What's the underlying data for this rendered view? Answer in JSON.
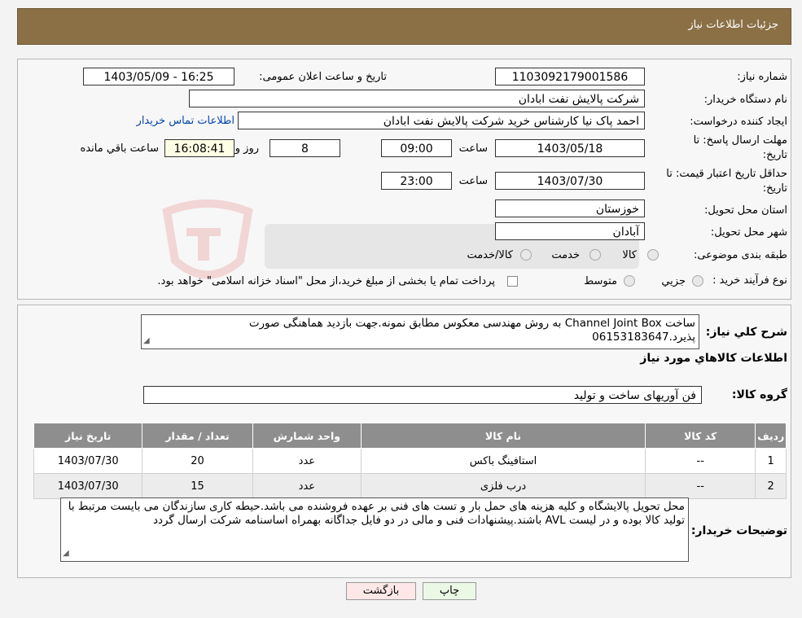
{
  "header": {
    "title": "جزئیات اطلاعات نیاز"
  },
  "form": {
    "need_number_label": "شماره نیاز:",
    "need_number": "1103092179001586",
    "announce_label": "تاریخ و ساعت اعلان عمومی:",
    "announce_value": "1403/05/09 - 16:25",
    "buyer_org_label": "نام دستگاه خریدار:",
    "buyer_org": "شرکت پالایش نفت ابادان",
    "creator_label": "ایجاد کننده درخواست:",
    "creator": "احمد پاک نیا کارشناس خرید شرکت پالایش نفت ابادان",
    "contact_link": "اطلاعات تماس خریدار",
    "deadline_label_1": "مهلت ارسال پاسخ: تا",
    "deadline_label_2": "تاریخ:",
    "deadline_date": "1403/05/18",
    "time_label": "ساعت",
    "deadline_time": "09:00",
    "days_value": "8",
    "days_label": "روز و",
    "remaining_time": "16:08:41",
    "remaining_label": "ساعت باقي مانده",
    "validity_label_1": "حداقل تاریخ اعتبار قیمت: تا",
    "validity_label_2": "تاریخ:",
    "validity_date": "1403/07/30",
    "validity_time": "23:00",
    "province_label": "استان محل تحویل:",
    "province": "خوزستان",
    "city_label": "شهر محل تحویل:",
    "city": "آبادان",
    "category_label": "طبقه بندی موضوعی:",
    "category_options": [
      "کالا",
      "خدمت",
      "کالا/خدمت"
    ],
    "process_label": "نوع فرآیند خرید :",
    "process_options": [
      "جزيي",
      "متوسط"
    ],
    "payment_note": "پرداخت تمام یا بخشی از مبلغ خرید،از محل \"اسناد خزانه اسلامی\" خواهد بود."
  },
  "description": {
    "label": "شرح كلي نياز:",
    "text": "ساخت Channel Joint Box به روش مهندسی معکوس مطابق نمونه.جهت بازدید هماهنگی صورت پذیرد.06153183647"
  },
  "goods": {
    "section_title": "اطلاعات كالاهاي مورد نياز",
    "group_label": "گروه کالا:",
    "group_value": "فن آوریهای ساخت و تولید",
    "columns": [
      "رديف",
      "كد كالا",
      "نام كالا",
      "واحد شمارش",
      "تعداد / مقدار",
      "تاريخ نياز"
    ],
    "rows": [
      {
        "idx": "1",
        "code": "--",
        "name": "استافینگ باکس",
        "unit": "عدد",
        "qty": "20",
        "date": "1403/07/30"
      },
      {
        "idx": "2",
        "code": "--",
        "name": "درب فلزی",
        "unit": "عدد",
        "qty": "15",
        "date": "1403/07/30"
      }
    ]
  },
  "buyer_notes": {
    "label": "توضیحات خریدار:",
    "text": "محل تحویل پالایشگاه و کلیه هزینه های حمل بار و تست های فنی بر عهده فروشنده می باشد.حیطه کاری سازندگان می بایست مرتبط با تولید کالا بوده و در لیست AVL باشند.پیشنهادات فنی و مالی در دو فایل جداگانه بهمراه اساسنامه شرکت ارسال گردد"
  },
  "buttons": {
    "print": "چاپ",
    "back": "بازگشت"
  },
  "colors": {
    "header_bg": "#8b7046",
    "table_header_bg": "#8e8e8e",
    "back_button_bg": "#fde7e7",
    "print_button_bg": "#ecf8e6"
  }
}
